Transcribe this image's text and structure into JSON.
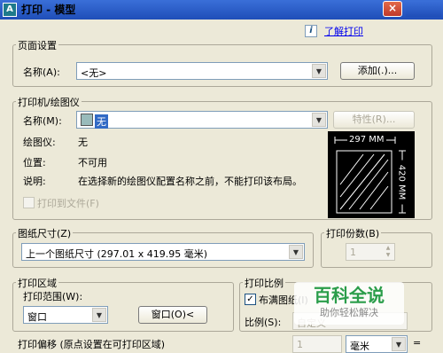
{
  "window": {
    "title": "打印 - 模型",
    "app_icon_letter": "A",
    "close_symbol": "×"
  },
  "help": {
    "info_icon": "i",
    "link": "了解打印"
  },
  "page_setup": {
    "group_title": "页面设置",
    "name_label": "名称(A):",
    "name_value": "<无>",
    "add_button": "添加(.)..."
  },
  "printer": {
    "group_title": "打印机/绘图仪",
    "name_label": "名称(M):",
    "name_value": "无",
    "properties_button": "特性(R)...",
    "plotter_label": "绘图仪:",
    "plotter_value": "无",
    "location_label": "位置:",
    "location_value": "不可用",
    "description_label": "说明:",
    "description_value": "在选择新的绘图仪配置名称之前，不能打印该布局。",
    "print_to_file": "打印到文件(F)",
    "preview_width": "297 MM",
    "preview_height": "420 MM"
  },
  "paper_size": {
    "group_title": "图纸尺寸(Z)",
    "value": "上一个图纸尺寸 (297.01 x 419.95 毫米)"
  },
  "copies": {
    "group_title": "打印份数(B)",
    "value": "1"
  },
  "plot_area": {
    "group_title": "打印区域",
    "range_label": "打印范围(W):",
    "range_value": "窗口",
    "window_button": "窗口(O)<"
  },
  "plot_scale": {
    "group_title": "打印比例",
    "fit_to_paper": "布满图纸(I)",
    "fit_checked": "✓",
    "scale_label": "比例(S):",
    "scale_value": "自定义",
    "unit_value": "1",
    "unit_name": "毫米",
    "equals": "="
  },
  "plot_offset": {
    "group_title": "打印偏移 (原点设置在可打印区域)"
  },
  "watermark": {
    "text": "百科全说",
    "subtext": "助你轻松解决"
  }
}
